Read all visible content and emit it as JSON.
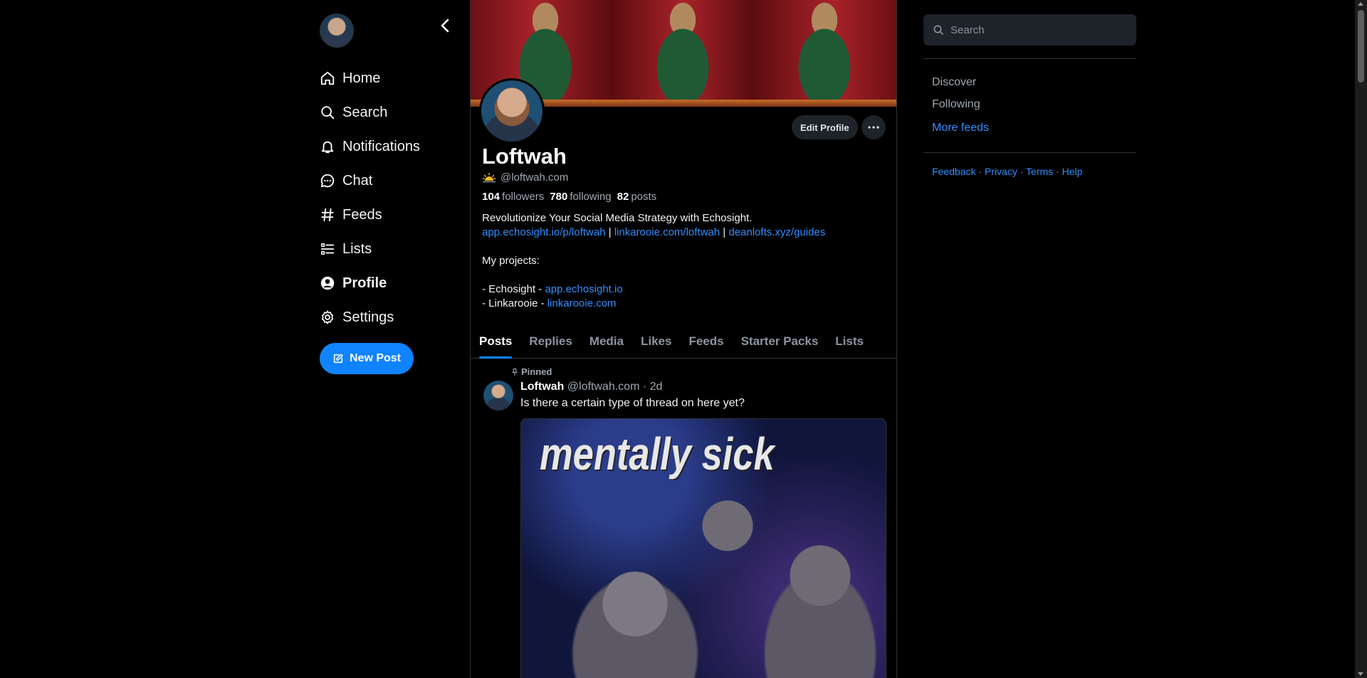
{
  "nav": {
    "items": [
      {
        "label": "Home",
        "icon": "home-icon"
      },
      {
        "label": "Search",
        "icon": "search-icon"
      },
      {
        "label": "Notifications",
        "icon": "bell-icon"
      },
      {
        "label": "Chat",
        "icon": "chat-icon"
      },
      {
        "label": "Feeds",
        "icon": "hash-icon"
      },
      {
        "label": "Lists",
        "icon": "list-icon"
      },
      {
        "label": "Profile",
        "icon": "profile-icon"
      },
      {
        "label": "Settings",
        "icon": "gear-icon"
      }
    ],
    "active": "Profile",
    "new_post_label": "New Post"
  },
  "profile": {
    "display_name": "Loftwah",
    "handle": "@loftwah.com",
    "edit_label": "Edit Profile",
    "stats": {
      "followers_count": "104",
      "followers_label": "followers",
      "following_count": "780",
      "following_label": "following",
      "posts_count": "82",
      "posts_label": "posts"
    },
    "bio": {
      "line1": "Revolutionize Your Social Media Strategy with Echosight.",
      "link1": "app.echosight.io/p/loftwah",
      "link2": "linkarooie.com/loftwah",
      "link3": "deanlofts.xyz/guides",
      "separator": "|",
      "projects_heading": "My projects:",
      "project1_prefix": "- Echosight - ",
      "project1_link": "app.echosight.io",
      "project2_prefix": "- Linkarooie - ",
      "project2_link": "linkarooie.com"
    }
  },
  "tabs": [
    "Posts",
    "Replies",
    "Media",
    "Likes",
    "Feeds",
    "Starter Packs",
    "Lists"
  ],
  "post": {
    "pinned_label": "Pinned",
    "author": "Loftwah",
    "handle": "@loftwah.com",
    "dot": "·",
    "age": "2d",
    "text": "Is there a certain type of thread on here yet?",
    "image_caption": "mentally sick"
  },
  "right": {
    "search_placeholder": "Search",
    "feeds": [
      "Discover",
      "Following"
    ],
    "more_feeds": "More feeds",
    "footer": [
      "Feedback",
      "Privacy",
      "Terms",
      "Help"
    ],
    "footer_sep": "·"
  },
  "colors": {
    "accent": "#1083fe",
    "link": "#2f8eff",
    "background": "#000000",
    "muted": "#9ea7b1"
  }
}
